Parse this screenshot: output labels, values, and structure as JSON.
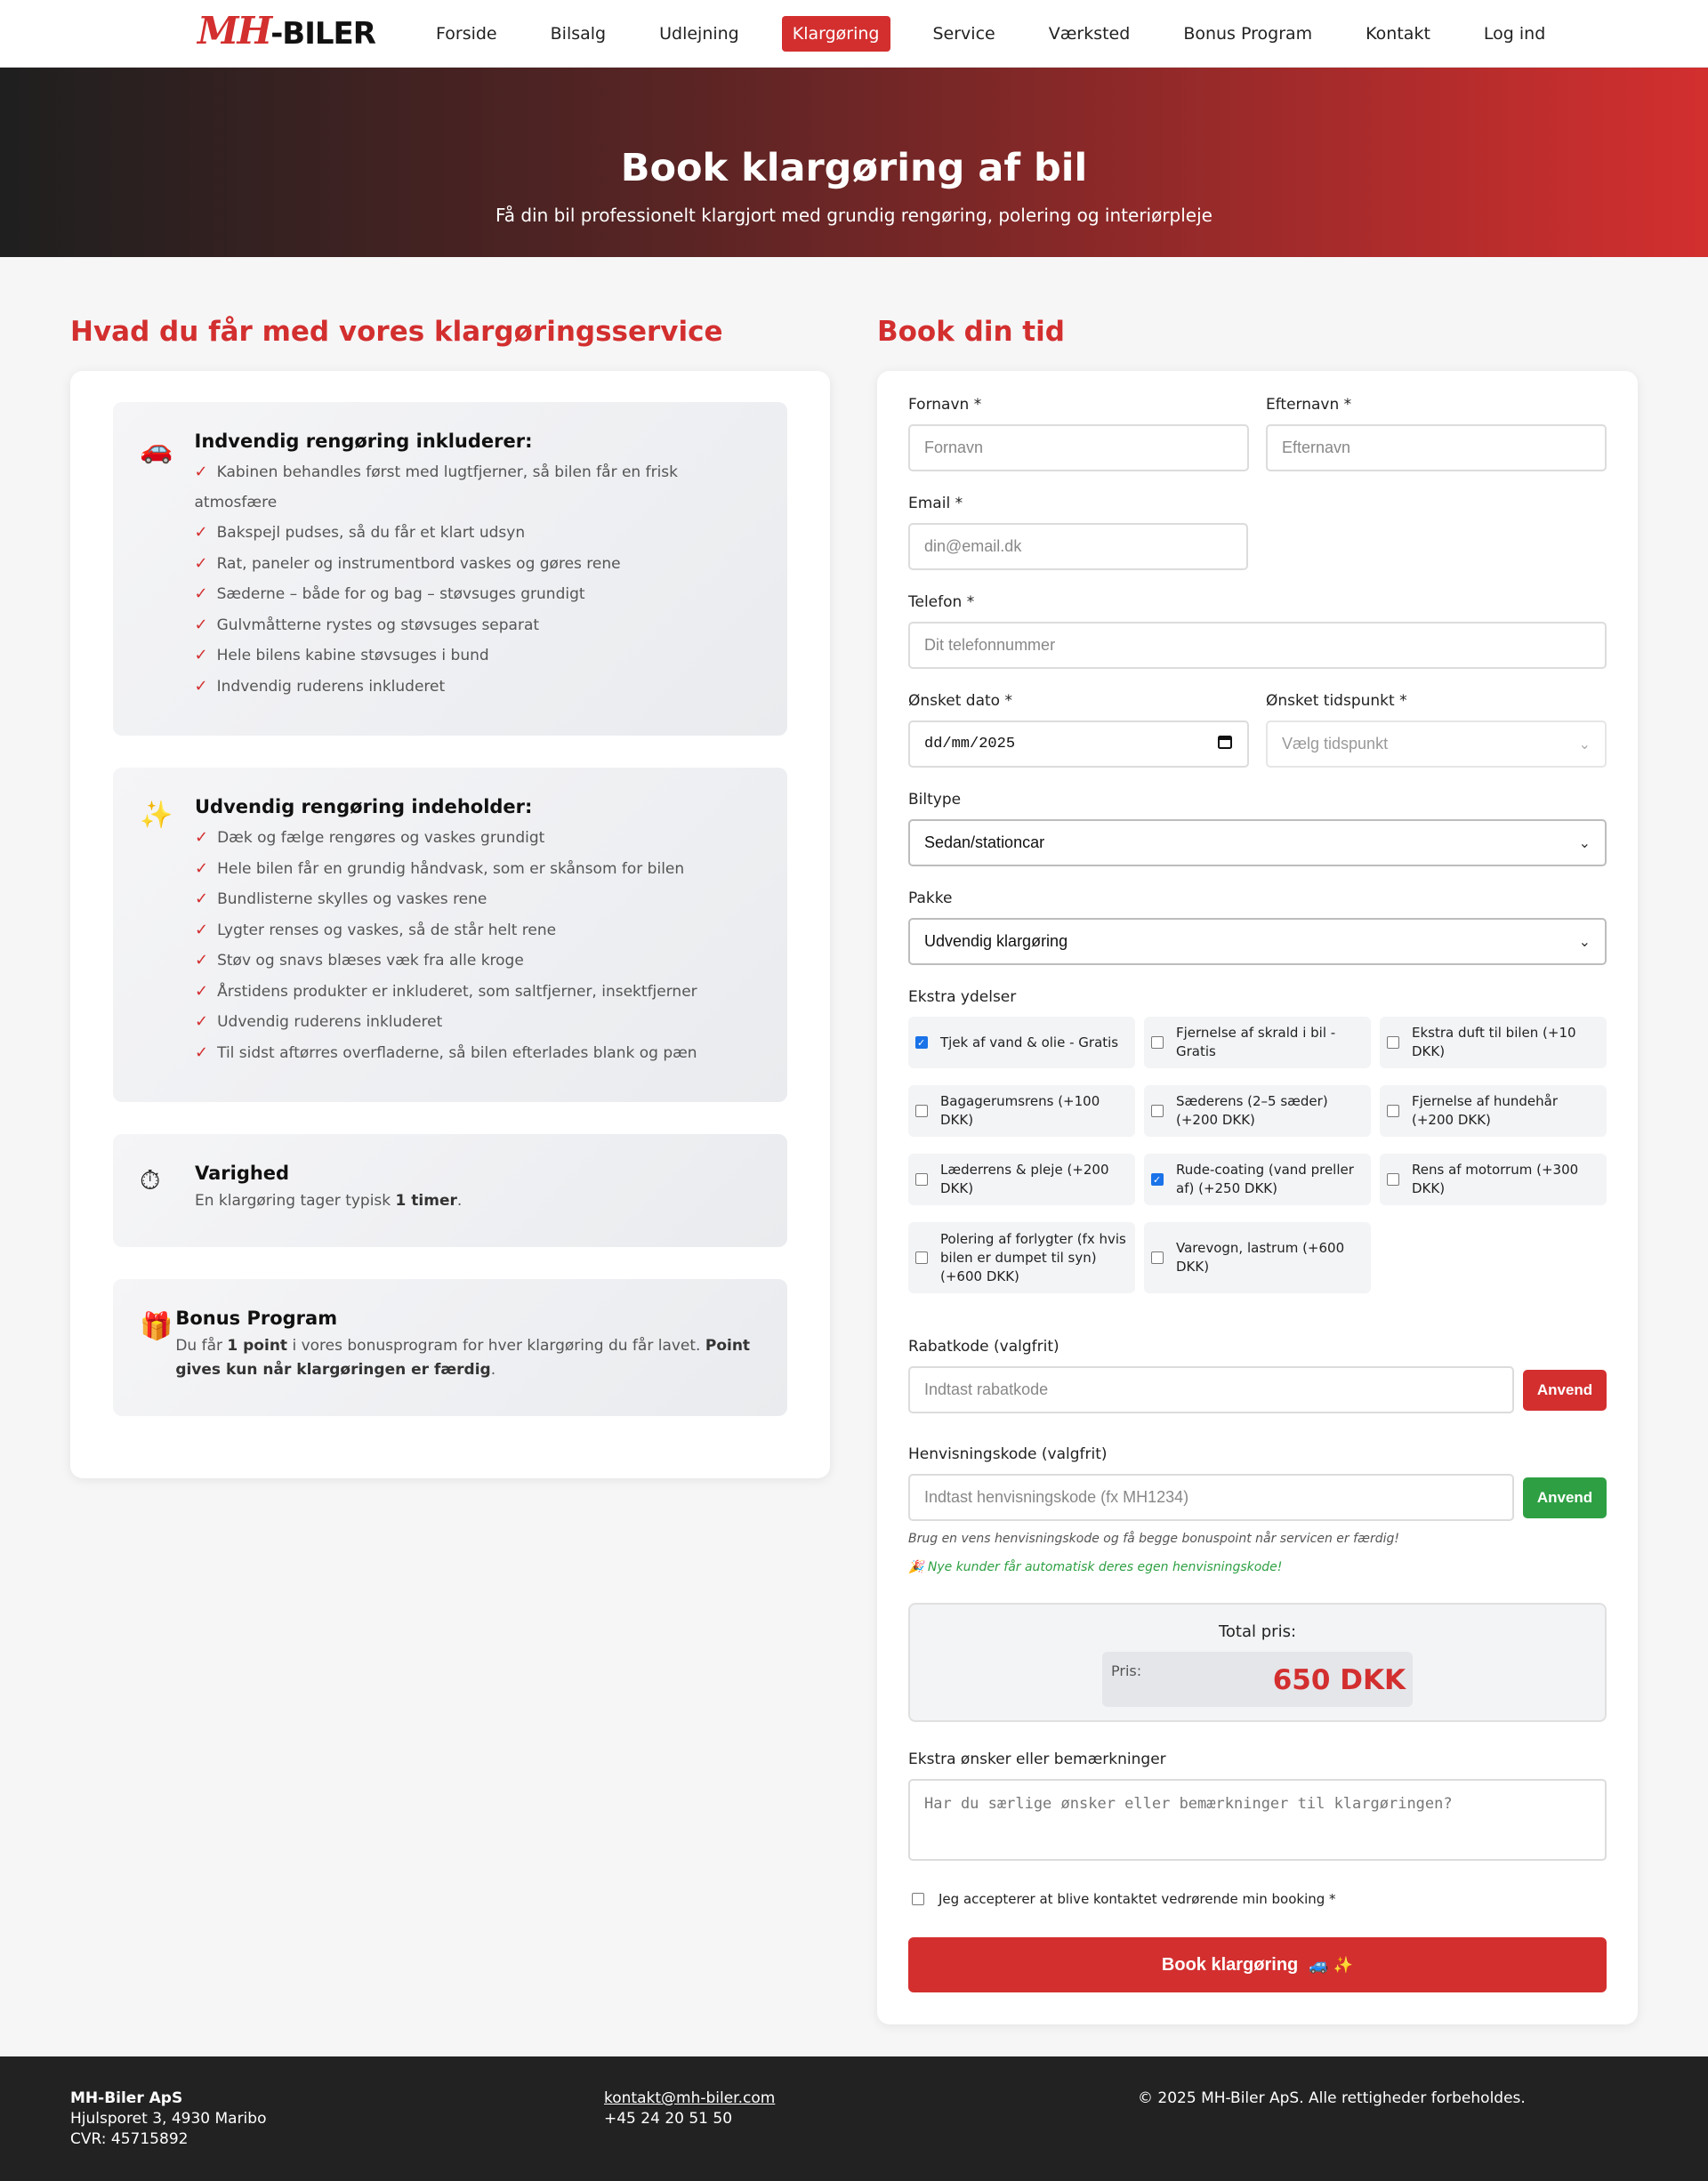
{
  "brand": {
    "script": "MH",
    "word": "-BILER"
  },
  "nav": [
    {
      "label": "Forside",
      "active": false
    },
    {
      "label": "Bilsalg",
      "active": false
    },
    {
      "label": "Udlejning",
      "active": false
    },
    {
      "label": "Klargøring",
      "active": true
    },
    {
      "label": "Service",
      "active": false
    },
    {
      "label": "Værksted",
      "active": false
    },
    {
      "label": "Bonus Program",
      "active": false
    },
    {
      "label": "Kontakt",
      "active": false
    },
    {
      "label": "Log ind",
      "active": false
    }
  ],
  "hero": {
    "title": "Book klargøring af bil",
    "subtitle": "Få din bil professionelt klargjort med grundig rengøring, polering og interiørpleje"
  },
  "left": {
    "heading": "Hvad du får med vores klargøringsservice",
    "interior": {
      "icon": "car-icon",
      "title": "Indvendig rengøring inkluderer:",
      "items": [
        "Kabinen behandles først med lugtfjerner, så bilen får en frisk atmosfære",
        "Bakspejl pudses, så du får et klart udsyn",
        "Rat, paneler og instrumentbord vaskes og gøres rene",
        "Sæderne – både for og bag – støvsuges grundigt",
        "Gulvmåtterne rystes og støvsuges separat",
        "Hele bilens kabine støvsuges i bund",
        "Indvendig ruderens inkluderet"
      ]
    },
    "exterior": {
      "icon": "sparkles-icon",
      "title": "Udvendig rengøring indeholder:",
      "items": [
        "Dæk og fælge rengøres og vaskes grundigt",
        "Hele bilen får en grundig håndvask, som er skånsom for bilen",
        "Bundlisterne skylles og vaskes rene",
        "Lygter renses og vaskes, så de står helt rene",
        "Støv og snavs blæses væk fra alle kroge",
        "Årstidens produkter er inkluderet, som saltfjerner, insektfjerner",
        "Udvendig ruderens inkluderet",
        "Til sidst aftørres overfladerne, så bilen efterlades blank og pæn"
      ]
    },
    "duration": {
      "icon": "stopwatch-icon",
      "title": "Varighed",
      "text_pre": "En klargøring tager typisk ",
      "text_bold": "1 timer",
      "text_post": "."
    },
    "bonus": {
      "icon": "gift-icon",
      "title": "Bonus Program",
      "text_pre": "Du får ",
      "text_bold1": "1 point",
      "text_mid": " i vores bonusprogram for hver klargøring du får lavet. ",
      "text_bold2": "Point gives kun når klargøringen er færdig",
      "text_post": "."
    }
  },
  "form": {
    "heading": "Book din tid",
    "first_name": {
      "label": "Fornavn *",
      "placeholder": "Fornavn"
    },
    "last_name": {
      "label": "Efternavn *",
      "placeholder": "Efternavn"
    },
    "email": {
      "label": "Email *",
      "placeholder": "din@email.dk"
    },
    "phone": {
      "label": "Telefon *",
      "placeholder": "Dit telefonnummer"
    },
    "date": {
      "label": "Ønsket dato *",
      "value": "dd/mm/2025",
      "icon": "calendar-icon"
    },
    "time": {
      "label": "Ønsket tidspunkt *",
      "placeholder": "Vælg tidspunkt"
    },
    "car_type": {
      "label": "Biltype",
      "value": "Sedan/stationcar"
    },
    "package": {
      "label": "Pakke",
      "value": "Udvendig klargøring"
    },
    "extras_label": "Ekstra ydelser",
    "extras": [
      {
        "label": "Tjek af vand & olie - Gratis",
        "checked": true
      },
      {
        "label": "Fjernelse af skrald i bil - Gratis",
        "checked": false
      },
      {
        "label": "Ekstra duft til bilen (+10 DKK)",
        "checked": false
      },
      {
        "label": "Bagagerumsrens (+100 DKK)",
        "checked": false
      },
      {
        "label": "Sæderens (2–5 sæder) (+200 DKK)",
        "checked": false
      },
      {
        "label": "Fjernelse af hundehår (+200 DKK)",
        "checked": false
      },
      {
        "label": "Læderrens & pleje (+200 DKK)",
        "checked": false
      },
      {
        "label": "Rude-coating (vand preller af) (+250 DKK)",
        "checked": true
      },
      {
        "label": "Rens af motorrum (+300 DKK)",
        "checked": false
      },
      {
        "label": "Polering af forlygter (fx hvis bilen er dumpet til syn) (+600 DKK)",
        "checked": false
      },
      {
        "label": "Varevogn, lastrum (+600 DKK)",
        "checked": false
      }
    ],
    "discount": {
      "label": "Rabatkode (valgfrit)",
      "placeholder": "Indtast rabatkode",
      "button": "Anvend"
    },
    "referral": {
      "label": "Henvisningskode (valgfrit)",
      "placeholder": "Indtast henvisningskode (fx MH1234)",
      "button": "Anvend",
      "hint": "Brug en vens henvisningskode og få begge bonuspoint når servicen er færdig!",
      "hint2": "🎉 Nye kunder får automatisk deres egen henvisningskode!"
    },
    "total": {
      "label": "Total pris:",
      "price_label": "Pris:",
      "price": "650 DKK"
    },
    "notes": {
      "label": "Ekstra ønsker eller bemærkninger",
      "placeholder": "Har du særlige ønsker eller bemærkninger til klargøringen?"
    },
    "accept": "Jeg accepterer at blive kontaktet vedrørende min booking *",
    "submit": "Book klargøring",
    "submit_emoji": "🚙 ✨"
  },
  "footer": {
    "company": "MH-Biler ApS",
    "address": "Hjulsporet 3, 4930 Maribo",
    "cvr": "CVR: 45715892",
    "email": "kontakt@mh-biler.com",
    "phone": "+45 24 20 51 50",
    "copyright": "© 2025 MH-Biler ApS. Alle rettigheder forbeholdes."
  },
  "colors": {
    "accent": "#d32f2f",
    "green": "#2ea043",
    "footer": "#222222"
  }
}
